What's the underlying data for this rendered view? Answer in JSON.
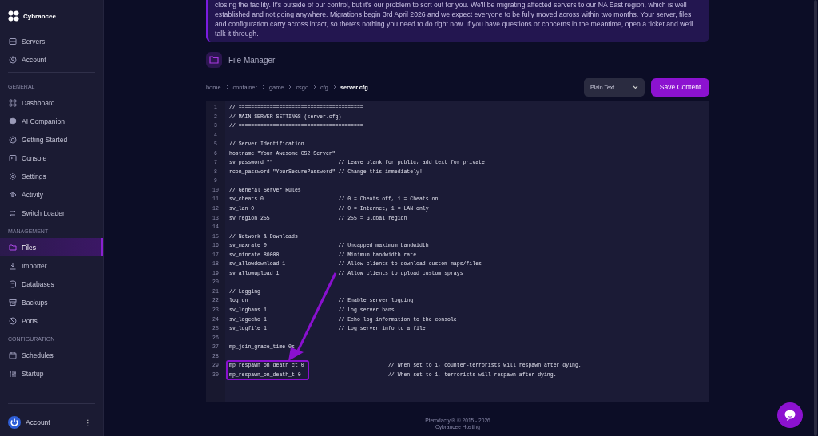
{
  "sidebar": {
    "brand": "Cybrancee",
    "sections": [
      {
        "items": [
          {
            "label": "Servers",
            "selected": false
          },
          {
            "label": "Account",
            "selected": false
          }
        ]
      },
      {
        "title": "GENERAL",
        "items": [
          {
            "label": "Dashboard",
            "selected": false
          },
          {
            "label": "AI Companion",
            "selected": false
          },
          {
            "label": "Getting Started",
            "selected": false
          },
          {
            "label": "Console",
            "selected": false
          },
          {
            "label": "Settings",
            "selected": false
          },
          {
            "label": "Activity",
            "selected": false
          },
          {
            "label": "Switch Loader",
            "selected": false
          }
        ]
      },
      {
        "title": "MANAGEMENT",
        "items": [
          {
            "label": "Files",
            "selected": true
          },
          {
            "label": "Importer",
            "selected": false
          },
          {
            "label": "Databases",
            "selected": false
          },
          {
            "label": "Backups",
            "selected": false
          },
          {
            "label": "Ports",
            "selected": false
          }
        ]
      },
      {
        "title": "CONFIGURATION",
        "items": [
          {
            "label": "Schedules",
            "selected": false
          },
          {
            "label": "Startup",
            "selected": false
          }
        ]
      }
    ],
    "account": {
      "label": "Account",
      "menu": "⋮"
    }
  },
  "banner": {
    "text": "closing the facility. It's outside of our control, but it's our problem to sort out for you. We'll be migrating affected servers to our NA East region, which is well established and not going anywhere. Migrations begin 3rd April 2026 and we expect everyone to be fully moved across within two months. Your server, files and configuration carry across intact, so there's nothing you need to do right now. If you have questions or concerns in the meantime, open a ticket and we'll talk it through."
  },
  "page_title": "File Manager",
  "breadcrumb": [
    "home",
    "container",
    "game",
    "csgo",
    "cfg",
    "server.cfg"
  ],
  "syntax": {
    "value": "Plain Text"
  },
  "save_button": "Save Content",
  "editor": {
    "lines": [
      {
        "number": "1",
        "code": "// ========================================"
      },
      {
        "number": "2",
        "code": "// MAIN SERVER SETTINGS (server.cfg)"
      },
      {
        "number": "3",
        "code": "// ========================================"
      },
      {
        "number": "4"
      },
      {
        "number": "5",
        "code": "// Server Identification"
      },
      {
        "number": "6",
        "code": "hostname \"Your Awesome CS2 Server\""
      },
      {
        "number": "7",
        "code": "sv_password \"\"                     // Leave blank for public, add text for private"
      },
      {
        "number": "8",
        "code": "rcon_password \"YourSecurePassword\" // Change this immediately!"
      },
      {
        "number": "9"
      },
      {
        "number": "10",
        "code": "// General Server Rules"
      },
      {
        "number": "11",
        "code": "sv_cheats 0                        // 0 = Cheats off, 1 = Cheats on"
      },
      {
        "number": "12",
        "code": "sv_lan 0                           // 0 = Internet, 1 = LAN only"
      },
      {
        "number": "13",
        "code": "sv_region 255                      // 255 = Global region"
      },
      {
        "number": "14"
      },
      {
        "number": "15",
        "code": "// Network & Downloads"
      },
      {
        "number": "16",
        "code": "sv_maxrate 0                       // Uncapped maximum bandwidth"
      },
      {
        "number": "17",
        "code": "sv_minrate 80000                   // Minimum bandwidth rate"
      },
      {
        "number": "18",
        "code": "sv_allowdownload 1                 // Allow clients to download custom maps/files"
      },
      {
        "number": "19",
        "code": "sv_allowupload 1                   // Allow clients to upload custom sprays"
      },
      {
        "number": "20"
      },
      {
        "number": "21",
        "code": "// Logging"
      },
      {
        "number": "22",
        "code": "log on                             // Enable server logging"
      },
      {
        "number": "23",
        "code": "sv_logbans 1                       // Log server bans"
      },
      {
        "number": "24",
        "code": "sv_logecho 1                       // Echo log information to the console"
      },
      {
        "number": "25",
        "code": "sv_logfile 1                       // Log server info to a file"
      },
      {
        "number": "26"
      },
      {
        "number": "27",
        "code": "mp_join_grace_time 0s"
      },
      {
        "number": "28"
      },
      {
        "number": "29",
        "code": "mp_respawn_on_death_ct 0                           // When set to 1, counter-terrorists will respawn after dying."
      },
      {
        "number": "30",
        "code": "mp_respawn_on_death_t 0                            // When set to 1, terrorists will respawn after dying."
      }
    ]
  },
  "footer": [
    "Pterodactyl® © 2015 - 2026",
    "Cybrancee Hosting"
  ]
}
